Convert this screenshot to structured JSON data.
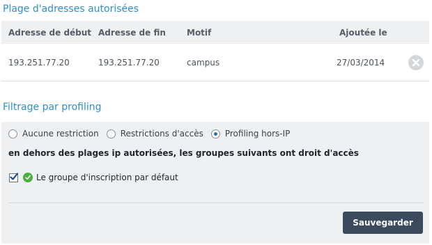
{
  "ip_section": {
    "title": "Plage d'adresses autorisées",
    "columns": {
      "start": "Adresse de début",
      "end": "Adresse de fin",
      "reason": "Motif",
      "added": "Ajoutée le"
    },
    "rows": [
      {
        "start": "193.251.77.20",
        "end": "193.251.77.20",
        "reason": "campus",
        "added": "27/03/2014",
        "remove_icon": "remove-circle-icon"
      }
    ]
  },
  "profiling_section": {
    "title": "Filtrage par profiling",
    "options": [
      {
        "label": "Aucune restriction",
        "selected": false
      },
      {
        "label": "Restrictions d'accès",
        "selected": false
      },
      {
        "label": "Profiling hors-IP",
        "selected": true
      }
    ],
    "note": "en dehors des plages ip autorisées, les groupes suivants ont droit d'accès",
    "groups": [
      {
        "label": "Le groupe d'inscription par défaut",
        "checked": true,
        "status_icon": "check-circle-icon"
      }
    ],
    "save_label": "Sauvegarder"
  },
  "colors": {
    "accent_title": "#2e8fc7",
    "panel_bg": "#eef0f2",
    "button_bg": "#3b4a5c",
    "success": "#4caf3e"
  }
}
